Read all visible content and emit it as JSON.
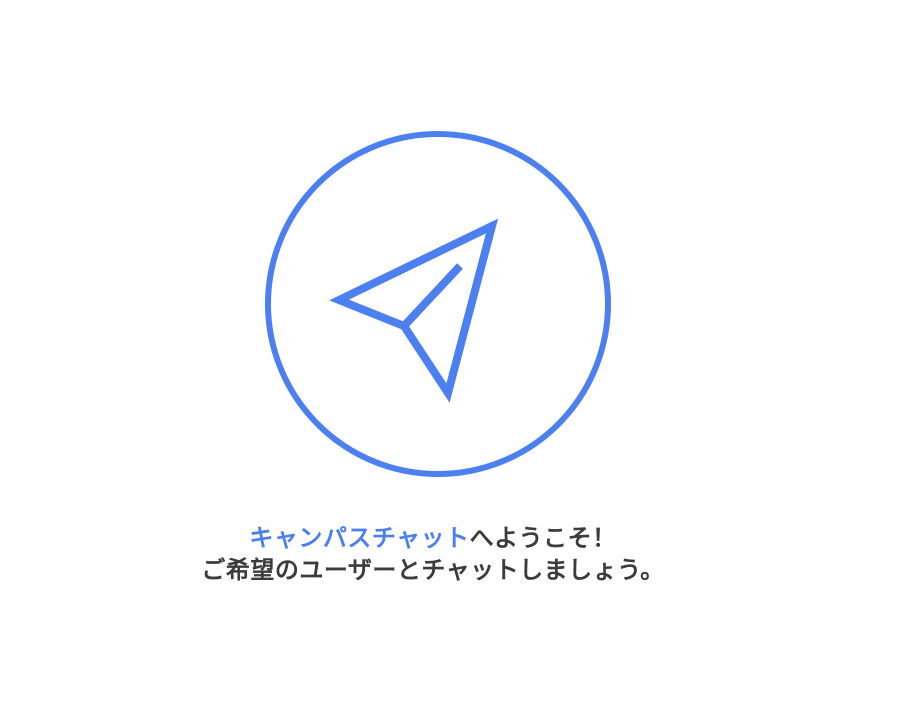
{
  "welcome": {
    "logo_icon": "paper-plane-icon",
    "accent_color": "#4c80f1",
    "text_color": "#3c3c3c",
    "app_name": "キャンパスチャット",
    "greeting_suffix": "へようこそ！",
    "instruction": "ご希望のユーザーとチャットしましょう。"
  }
}
